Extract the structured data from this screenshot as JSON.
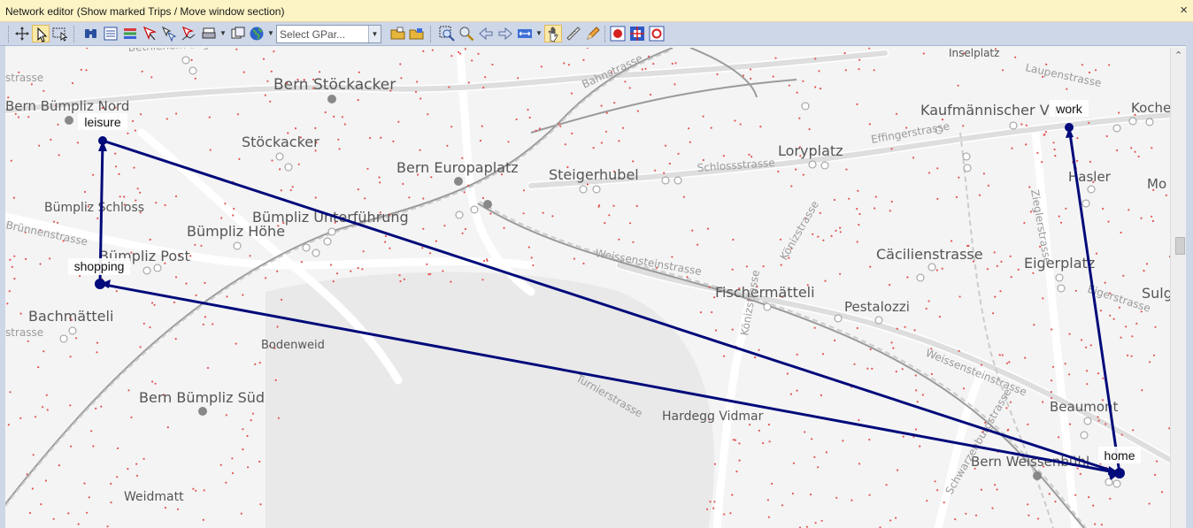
{
  "window": {
    "title": "Network editor (Show marked Trips / Move window section)",
    "close_glyph": "×"
  },
  "toolbar": {
    "gpar_placeholder": "Select GPar...",
    "icons": [
      "move-icon",
      "select-icon",
      "select-area-icon",
      "find-icon",
      "list-icon",
      "layers-icon",
      "mark-icon",
      "mark-multi-icon",
      "mark-path-icon",
      "print-icon",
      "screen-icon",
      "globe-icon",
      "open-icon",
      "save-icon",
      "zoom-area-icon",
      "zoom-icon",
      "back-icon",
      "forward-icon",
      "fit-icon",
      "pan-icon",
      "measure-icon",
      "edit-icon",
      "record-icon",
      "center-icon",
      "snapshot-icon"
    ]
  },
  "map": {
    "trip_color": "#000a7a",
    "nodes": {
      "leisure": "leisure",
      "shopping": "shopping",
      "work": "work",
      "home": "home"
    },
    "places": [
      "Bern Stöckacker",
      "Bern Bümpliz Nord",
      "Stöckacker",
      "Bern Europaplatz",
      "Steigerhubel",
      "Loryplatz",
      "Kaufmännischer V   nd",
      "Kocherpa",
      "Hasler",
      "Mo",
      "Bümpliz Schloss",
      "Bümpliz Unterführung",
      "Bümpliz Höhe",
      "Bümpliz Post",
      "Cäcilienstrasse",
      "Eigerplatz",
      "Sulg",
      "Fischermätteli",
      "Pestalozzi",
      "Bachmätteli",
      "Bodenweid",
      "Bern Bümpliz Süd",
      "Hardegg Vidmar",
      "Beaumont",
      "Bern Weissenbühl",
      "Weidmatt",
      "Inselplatz"
    ],
    "streets": [
      "Bethlehem Säge",
      "Bahnstrasse",
      "Laupenstrasse",
      "Effingerstrasse",
      "Schlossstrasse",
      "Zieglerstrasse",
      "Könizstrasse",
      "Weissensteinstrasse",
      "Brünnenstrasse",
      "Könizstrasse",
      "Turnierstrasse",
      "Weissensteinstrasse",
      "Eigerstrasse",
      "Schwarzenburgstrasse",
      "strasse",
      "strasse"
    ]
  }
}
